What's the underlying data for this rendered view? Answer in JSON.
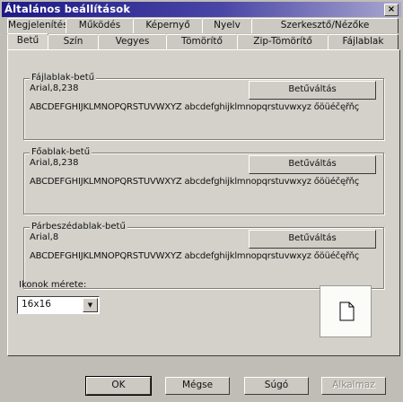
{
  "window": {
    "title": "Általános beállítások",
    "close_glyph": "×"
  },
  "tabs_top": [
    "Megjelenítés",
    "Működés",
    "Képernyő",
    "Nyelv",
    "Szerkesztő/Nézőke"
  ],
  "tabs_bottom": [
    "Betű",
    "Szín",
    "Vegyes",
    "Tömörítő",
    "Zip-Tömörítő",
    "Fájlablak"
  ],
  "active_tab": "Betű",
  "font_groups": [
    {
      "title": "Fájlablak-betű",
      "value": "Arial,8,238",
      "button": "Betűváltás",
      "sample": "ABCDEFGHIJKLMNOPQRSTUVWXYZ abcdefghijklmnopqrstuvwxyz őöüéčęřňç"
    },
    {
      "title": "Főablak-betű",
      "value": "Arial,8,238",
      "button": "Betűváltás",
      "sample": "ABCDEFGHIJKLMNOPQRSTUVWXYZ abcdefghijklmnopqrstuvwxyz őöüéčęřňç"
    },
    {
      "title": "Párbeszédablak-betű",
      "value": "Arial,8",
      "button": "Betűváltás",
      "sample": "ABCDEFGHIJKLMNOPQRSTUVWXYZ abcdefghijklmnopqrstuvwxyz őöüéčęřňç"
    }
  ],
  "icon_size": {
    "label": "Ikonok mérete:",
    "value": "16x16",
    "preview_icon": "document-icon"
  },
  "buttons": {
    "ok": "OK",
    "cancel": "Mégse",
    "help": "Súgó",
    "apply": "Alkalmaz"
  }
}
